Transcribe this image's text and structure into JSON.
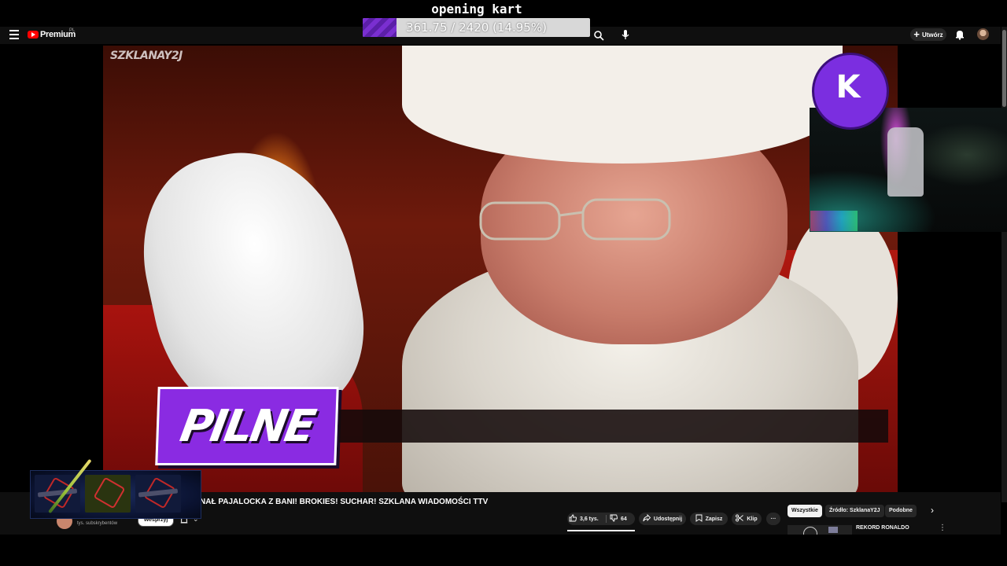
{
  "stream_goal": {
    "title": "opening kart",
    "progress_text": "361.75 / 2420 (14.95%)",
    "current": 361.75,
    "target": 2420,
    "percent": 14.95
  },
  "header": {
    "brand": "Premium",
    "region": "PL",
    "create_label": "Utwórz"
  },
  "video": {
    "watermark": "SZKLANAY2J",
    "news_label": "PILNE"
  },
  "details": {
    "title": "NAŁ PAJALOCKA Z BANI! BROKIES! SUCHAR! SZKLANA WIADOMOŚCI TTV",
    "subscribers": "tys. subskrybentów",
    "support_label": "Wesprzyj",
    "likes": "3,6 tys.",
    "dislikes": "64",
    "share_label": "Udostępnij",
    "save_label": "Zapisz",
    "clip_label": "Klip",
    "more_label": "···"
  },
  "recommendations": {
    "chips": [
      "Wszystkie",
      "Źródło: SzklanaY2J",
      "Podobne"
    ],
    "active_chip": "Wszystkie",
    "first_title": "REKORD RONALDO"
  },
  "colors": {
    "accent_purple": "#8a2be2",
    "youtube_red": "#ff0000",
    "page_bg": "#0f0f0f"
  }
}
